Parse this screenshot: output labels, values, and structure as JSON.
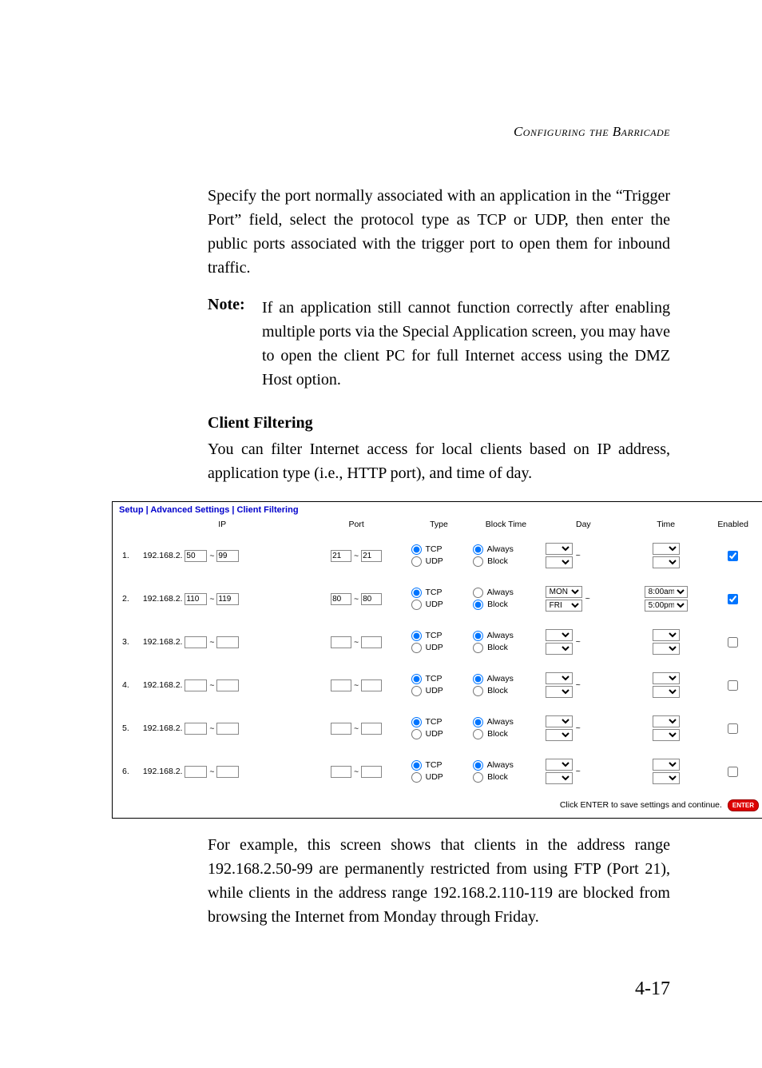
{
  "running_head": "Configuring the Barricade",
  "para1": "Specify the port normally associated with an application in the “Trigger Port” field, select the protocol type as TCP or UDP, then enter the public ports associated with the trigger port to open them for inbound traffic.",
  "note_label": "Note:",
  "note_body": "If an application still cannot function correctly after enabling multiple ports via the Special Application screen, you may have to open the client PC for full Internet access using the DMZ Host option.",
  "heading": "Client Filtering",
  "para2": "You can filter Internet access for local clients based on IP address, application type (i.e., HTTP port), and time of day.",
  "para3": "For example, this screen shows that clients in the address range 192.168.2.50-99 are permanently restricted from using FTP (Port 21), while clients in the address range 192.168.2.110-119 are blocked from browsing the Internet from Monday through Friday.",
  "page_number": "4-17",
  "screenshot": {
    "breadcrumb": "Setup | Advanced Settings | Client Filtering",
    "headers": {
      "ip": "IP",
      "port": "Port",
      "type": "Type",
      "block": "Block Time",
      "day": "Day",
      "time": "Time",
      "enabled": "Enabled"
    },
    "ip_prefix": "192.168.2.",
    "type_tcp": "TCP",
    "type_udp": "UDP",
    "block_always": "Always",
    "block_block": "Block",
    "footer_text": "Click ENTER to save settings and continue.",
    "enter_label": "ENTER",
    "rows": [
      {
        "n": "1.",
        "ip_from": "50",
        "ip_to": "99",
        "port_from": "21",
        "port_to": "21",
        "tcp": true,
        "always": true,
        "day_from": "",
        "day_to": "",
        "time_from": "",
        "time_to": "",
        "enabled": true
      },
      {
        "n": "2.",
        "ip_from": "110",
        "ip_to": "119",
        "port_from": "80",
        "port_to": "80",
        "tcp": true,
        "always": false,
        "day_from": "MON",
        "day_to": "FRI",
        "time_from": "8:00am",
        "time_to": "5:00pm",
        "enabled": true
      },
      {
        "n": "3.",
        "ip_from": "",
        "ip_to": "",
        "port_from": "",
        "port_to": "",
        "tcp": true,
        "always": true,
        "day_from": "",
        "day_to": "",
        "time_from": "",
        "time_to": "",
        "enabled": false
      },
      {
        "n": "4.",
        "ip_from": "",
        "ip_to": "",
        "port_from": "",
        "port_to": "",
        "tcp": true,
        "always": true,
        "day_from": "",
        "day_to": "",
        "time_from": "",
        "time_to": "",
        "enabled": false
      },
      {
        "n": "5.",
        "ip_from": "",
        "ip_to": "",
        "port_from": "",
        "port_to": "",
        "tcp": true,
        "always": true,
        "day_from": "",
        "day_to": "",
        "time_from": "",
        "time_to": "",
        "enabled": false
      },
      {
        "n": "6.",
        "ip_from": "",
        "ip_to": "",
        "port_from": "",
        "port_to": "",
        "tcp": true,
        "always": true,
        "day_from": "",
        "day_to": "",
        "time_from": "",
        "time_to": "",
        "enabled": false
      }
    ]
  }
}
